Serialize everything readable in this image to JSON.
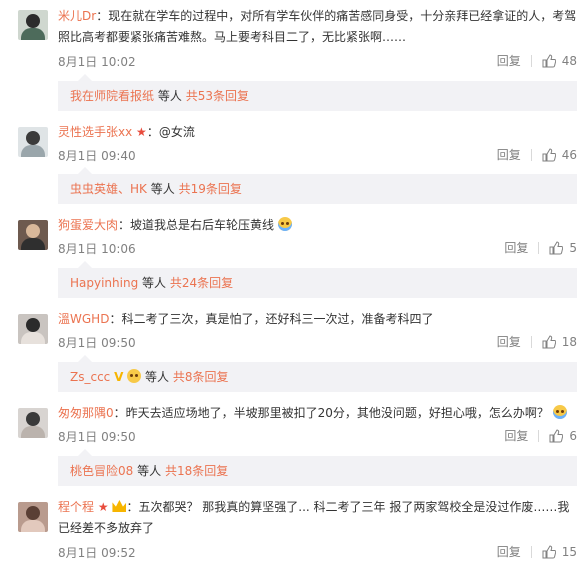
{
  "comments": [
    {
      "user": "米儿Dr",
      "badge": "",
      "text_line1": "现在就在学车的过程中，对所有学车伙伴的痛苦感同身受，十分亲拜已经拿证的人，考驾",
      "text_line2": "照比高考都要紧张痛苦难熬。马上要考科目二了，无比紧张啊……",
      "emoji": "",
      "date": "8月1日 10:02",
      "reply_label": "回复",
      "likes": "48",
      "sub": {
        "users": "我在师院看报纸",
        "suffix": "等人",
        "total": "共53条回复"
      }
    },
    {
      "user": "灵性选手张xx",
      "badge": "star",
      "text_line1": "@女流",
      "date": "8月1日 09:40",
      "reply_label": "回复",
      "likes": "46",
      "sub": {
        "users": "虫虫英雄、HK",
        "suffix": "等人",
        "total": "共19条回复"
      }
    },
    {
      "user": "狗蛋爱大肉",
      "badge": "",
      "text_line1": "坡道我总是右后车轮压黄线",
      "emoji": "cry",
      "date": "8月1日 10:06",
      "reply_label": "回复",
      "likes": "5",
      "sub": {
        "users": "Hapyinhing",
        "suffix": "等人",
        "total": "共24条回复"
      }
    },
    {
      "user": "溫WGHD",
      "badge": "",
      "text_line1": "科二考了三次，真是怕了，还好科三一次过，准备考科四了",
      "date": "8月1日 09:50",
      "reply_label": "回复",
      "likes": "18",
      "sub": {
        "users": "Zs_ccc",
        "suffix": "等人",
        "total": "共8条回复"
      }
    },
    {
      "user": "匆匆那隅0",
      "badge": "",
      "text_line1": "昨天去适应场地了，半坡那里被扣了20分，其他没问题，好担心哦，怎么办啊？",
      "emoji": "cry",
      "date": "8月1日 09:50",
      "reply_label": "回复",
      "likes": "6",
      "sub": {
        "users": "桃色冒险08",
        "suffix": "等人",
        "total": "共18条回复"
      }
    },
    {
      "user": "程个程",
      "badge": "star-crown",
      "text_line1": "五次都哭？ 那我真的算坚强了... 科二考了三年 报了两家驾校全是没过作废……我",
      "text_line2": "已经差不多放弃了",
      "date": "8月1日 09:52",
      "reply_label": "回复",
      "likes": "15"
    }
  ],
  "colors": {
    "username": "#eb7350",
    "meta": "#808080",
    "subbox_bg": "#f2f2f5"
  }
}
